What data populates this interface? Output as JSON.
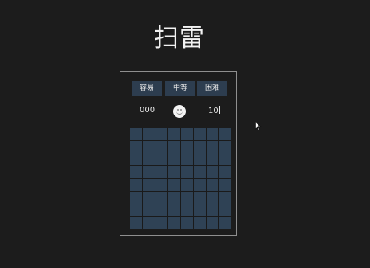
{
  "title": "扫雷",
  "difficulty": {
    "easy_label": "容易",
    "medium_label": "中等",
    "hard_label": "困难"
  },
  "status": {
    "timer": "000",
    "mines_remaining": "10",
    "face_state": "smile"
  },
  "board": {
    "rows": 8,
    "cols": 8,
    "cell_state": "unrevealed"
  },
  "colors": {
    "background": "#1c1c1c",
    "button": "#2d3d4f",
    "cell": "#2f4255",
    "panel_border": "#8f8f8f",
    "face": "#f3f3f3"
  }
}
